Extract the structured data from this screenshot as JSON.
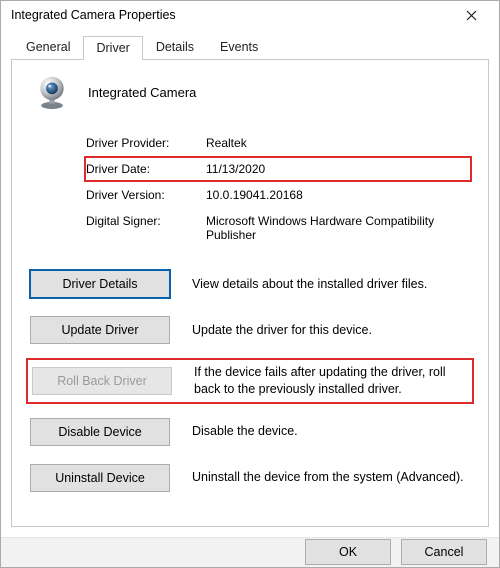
{
  "window": {
    "title": "Integrated Camera Properties"
  },
  "tabs": {
    "general": "General",
    "driver": "Driver",
    "details": "Details",
    "events": "Events"
  },
  "device": {
    "name": "Integrated Camera"
  },
  "info": {
    "provider_label": "Driver Provider:",
    "provider_value": "Realtek",
    "date_label": "Driver Date:",
    "date_value": "11/13/2020",
    "version_label": "Driver Version:",
    "version_value": "10.0.19041.20168",
    "signer_label": "Digital Signer:",
    "signer_value": "Microsoft Windows Hardware Compatibility Publisher"
  },
  "actions": {
    "details_btn": "Driver Details",
    "details_desc": "View details about the installed driver files.",
    "update_btn": "Update Driver",
    "update_desc": "Update the driver for this device.",
    "rollback_btn": "Roll Back Driver",
    "rollback_desc": "If the device fails after updating the driver, roll back to the previously installed driver.",
    "disable_btn": "Disable Device",
    "disable_desc": "Disable the device.",
    "uninstall_btn": "Uninstall Device",
    "uninstall_desc": "Uninstall the device from the system (Advanced)."
  },
  "footer": {
    "ok": "OK",
    "cancel": "Cancel"
  }
}
